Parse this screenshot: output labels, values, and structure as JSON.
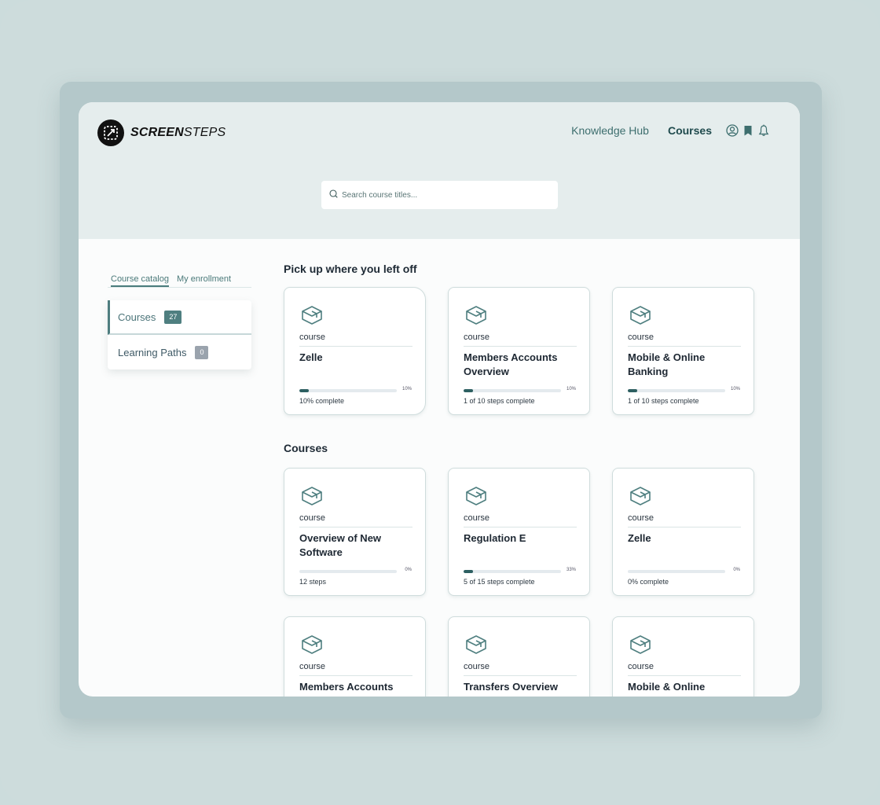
{
  "brand": {
    "name_bold": "SCREEN",
    "name_light": "STEPS"
  },
  "nav": {
    "links": [
      {
        "label": "Knowledge Hub",
        "active": false
      },
      {
        "label": "Courses",
        "active": true
      }
    ],
    "icons": [
      "user-circle-icon",
      "bookmark-icon",
      "bell-icon"
    ]
  },
  "search": {
    "placeholder": "Search course titles...",
    "value": ""
  },
  "sidebar": {
    "tabs": [
      {
        "label": "Course catalog",
        "active": true
      },
      {
        "label": "My enrollment",
        "active": false
      }
    ],
    "items": [
      {
        "label": "Courses",
        "count": "27",
        "active": true
      },
      {
        "label": "Learning Paths",
        "count": "0",
        "active": false
      }
    ]
  },
  "colors": {
    "accent": "#2d5f61",
    "badge_teal": "#4f7f80",
    "badge_gray": "#9aa3ad",
    "header_bg": "#e5eded"
  },
  "sections": {
    "recent": {
      "title": "Pick up where you left off",
      "cards": [
        {
          "type": "course",
          "title": "Zelle",
          "progress": 10,
          "progress_label": "10%",
          "status": "10% complete"
        },
        {
          "type": "course",
          "title": "Members Accounts Overview",
          "progress": 10,
          "progress_label": "10%",
          "status": "1 of 10 steps complete"
        },
        {
          "type": "course",
          "title": "Mobile & Online Banking",
          "progress": 10,
          "progress_label": "10%",
          "status": "1 of 10 steps complete"
        }
      ]
    },
    "courses": {
      "title": "Courses",
      "cards": [
        {
          "type": "course",
          "title": "Overview of New Software",
          "progress": 0,
          "progress_label": "0%",
          "status": "12 steps"
        },
        {
          "type": "course",
          "title": "Regulation E",
          "progress": 10,
          "progress_label": "33%",
          "status": "5 of 15 steps complete"
        },
        {
          "type": "course",
          "title": "Zelle",
          "progress": 0,
          "progress_label": "0%",
          "status": "0% complete"
        },
        {
          "type": "course",
          "title": "Members Accounts",
          "progress": null,
          "progress_label": "",
          "status": ""
        },
        {
          "type": "course",
          "title": "Transfers Overview",
          "progress": null,
          "progress_label": "",
          "status": ""
        },
        {
          "type": "course",
          "title": "Mobile & Online",
          "progress": null,
          "progress_label": "",
          "status": ""
        }
      ]
    }
  }
}
